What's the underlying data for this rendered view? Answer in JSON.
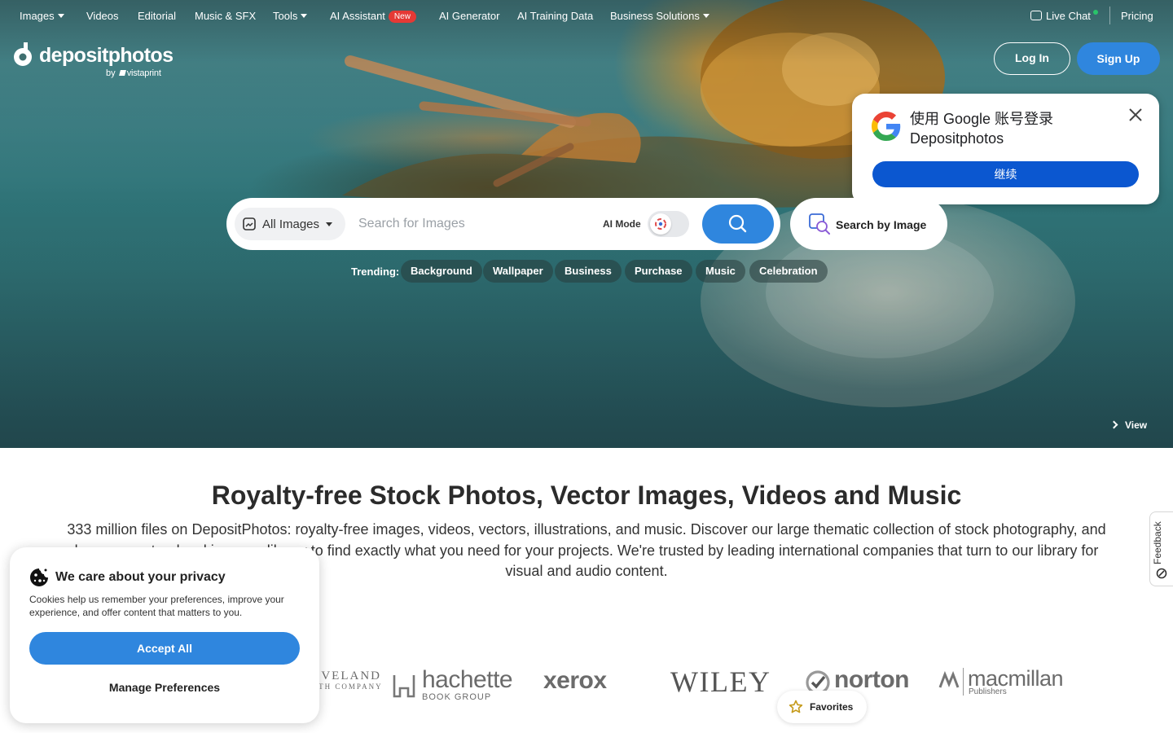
{
  "nav": {
    "items": [
      {
        "label": "Images",
        "has_caret": true
      },
      {
        "label": "Videos"
      },
      {
        "label": "Editorial"
      },
      {
        "label": "Music & SFX"
      },
      {
        "label": "Tools",
        "has_caret": true
      },
      {
        "label": "AI Assistant",
        "badge": "New"
      },
      {
        "label": "AI Generator"
      },
      {
        "label": "AI Training Data"
      },
      {
        "label": "Business Solutions",
        "has_caret": true
      }
    ],
    "live_chat": "Live Chat",
    "pricing": "Pricing"
  },
  "logo": {
    "text": "depositphotos",
    "by": "by",
    "partner": "vistaprint"
  },
  "auth": {
    "login": "Log In",
    "signup": "Sign Up"
  },
  "google_popup": {
    "title": "使用 Google 账号登录 Depositphotos",
    "continue": "继续"
  },
  "search": {
    "type": "All Images",
    "placeholder": "Search for Images",
    "ai_mode": "AI Mode",
    "by_image": "Search by Image"
  },
  "trending": {
    "label": "Trending:",
    "items": [
      "Background",
      "Wallpaper",
      "Business",
      "Purchase",
      "Music",
      "Celebration"
    ]
  },
  "hero": {
    "view": "View"
  },
  "headline": "Royalty-free Stock Photos, Vector Images, Videos and Music",
  "intro": "333 million files on DepositPhotos: royalty-free images, videos, vectors, illustrations, and music. Discover our large thematic collection of stock photography, and",
  "intro_rest": "browse our top-level imagery library to find exactly what you need for your projects. We're trusted by leading international companies that turn to our library for visual and audio content.",
  "clients": [
    {
      "name": "CLEVELAND",
      "sub": "HEALTH COMPANY"
    },
    {
      "name": "hachette",
      "sub": "BOOK GROUP"
    },
    {
      "name": "xerox"
    },
    {
      "name": "WILEY"
    },
    {
      "name": "norton"
    },
    {
      "name": "macmillan",
      "sub": "Publishers"
    }
  ],
  "feedback": "Feedback",
  "favorites": "Favorites",
  "cookie": {
    "title": "We care about your privacy",
    "text": "Cookies help us remember your preferences, improve your experience, and offer content that matters to you.",
    "accept": "Accept All",
    "manage": "Manage Preferences"
  },
  "colors": {
    "accent": "#2f86de",
    "google_blue": "#0b57d0",
    "new_badge": "#e53935"
  }
}
